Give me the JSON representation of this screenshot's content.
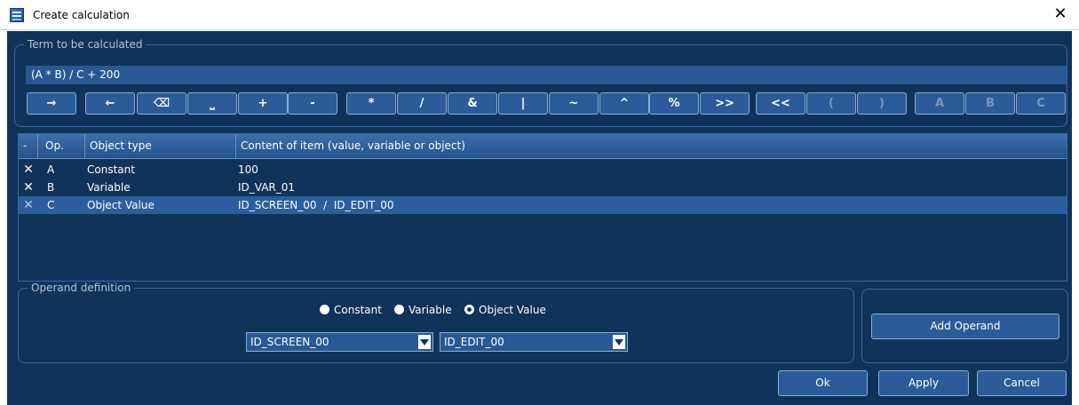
{
  "window": {
    "title": "Create calculation",
    "close_glyph": "✕"
  },
  "term": {
    "legend": "Term to be calculated",
    "value": "(A * B) / C + 200"
  },
  "operators": [
    {
      "label": "→",
      "enabled": true
    },
    {
      "label": "←",
      "enabled": true
    },
    {
      "label": "⌫",
      "enabled": true
    },
    {
      "label": "⎵",
      "enabled": true
    },
    {
      "label": "+",
      "enabled": true
    },
    {
      "label": "-",
      "enabled": true
    },
    {
      "label": "*",
      "enabled": true
    },
    {
      "label": "/",
      "enabled": true
    },
    {
      "label": "&",
      "enabled": true
    },
    {
      "label": "|",
      "enabled": true
    },
    {
      "label": "~",
      "enabled": true
    },
    {
      "label": "^",
      "enabled": true
    },
    {
      "label": "%",
      "enabled": true
    },
    {
      "label": ">>",
      "enabled": true
    },
    {
      "label": "<<",
      "enabled": true
    },
    {
      "label": "(",
      "enabled": false
    },
    {
      "label": ")",
      "enabled": false
    },
    {
      "label": "A",
      "enabled": false
    },
    {
      "label": "B",
      "enabled": false
    },
    {
      "label": "C",
      "enabled": false
    }
  ],
  "table": {
    "headers": [
      "-",
      "Op.",
      "Object type",
      "Content of item (value, variable or object)"
    ],
    "rows": [
      {
        "op": "A",
        "type": "Constant",
        "content": "100",
        "selected": false
      },
      {
        "op": "B",
        "type": "Variable",
        "content": "ID_VAR_01",
        "selected": false
      },
      {
        "op": "C",
        "type": "Object Value",
        "content": "ID_SCREEN_00  /  ID_EDIT_00",
        "selected": true
      }
    ]
  },
  "operand": {
    "legend": "Operand definition",
    "radios": [
      {
        "label": "Constant",
        "checked": false
      },
      {
        "label": "Variable",
        "checked": false
      },
      {
        "label": "Object Value",
        "checked": true
      }
    ],
    "screen_select": "ID_SCREEN_00",
    "item_select": "ID_EDIT_00"
  },
  "buttons": {
    "add_operand": "Add Operand",
    "ok": "Ok",
    "apply": "Apply",
    "cancel": "Cancel"
  },
  "colors": {
    "background": "#0f3359",
    "accent": "#2b5c99",
    "selection": "#2c5e9e"
  }
}
